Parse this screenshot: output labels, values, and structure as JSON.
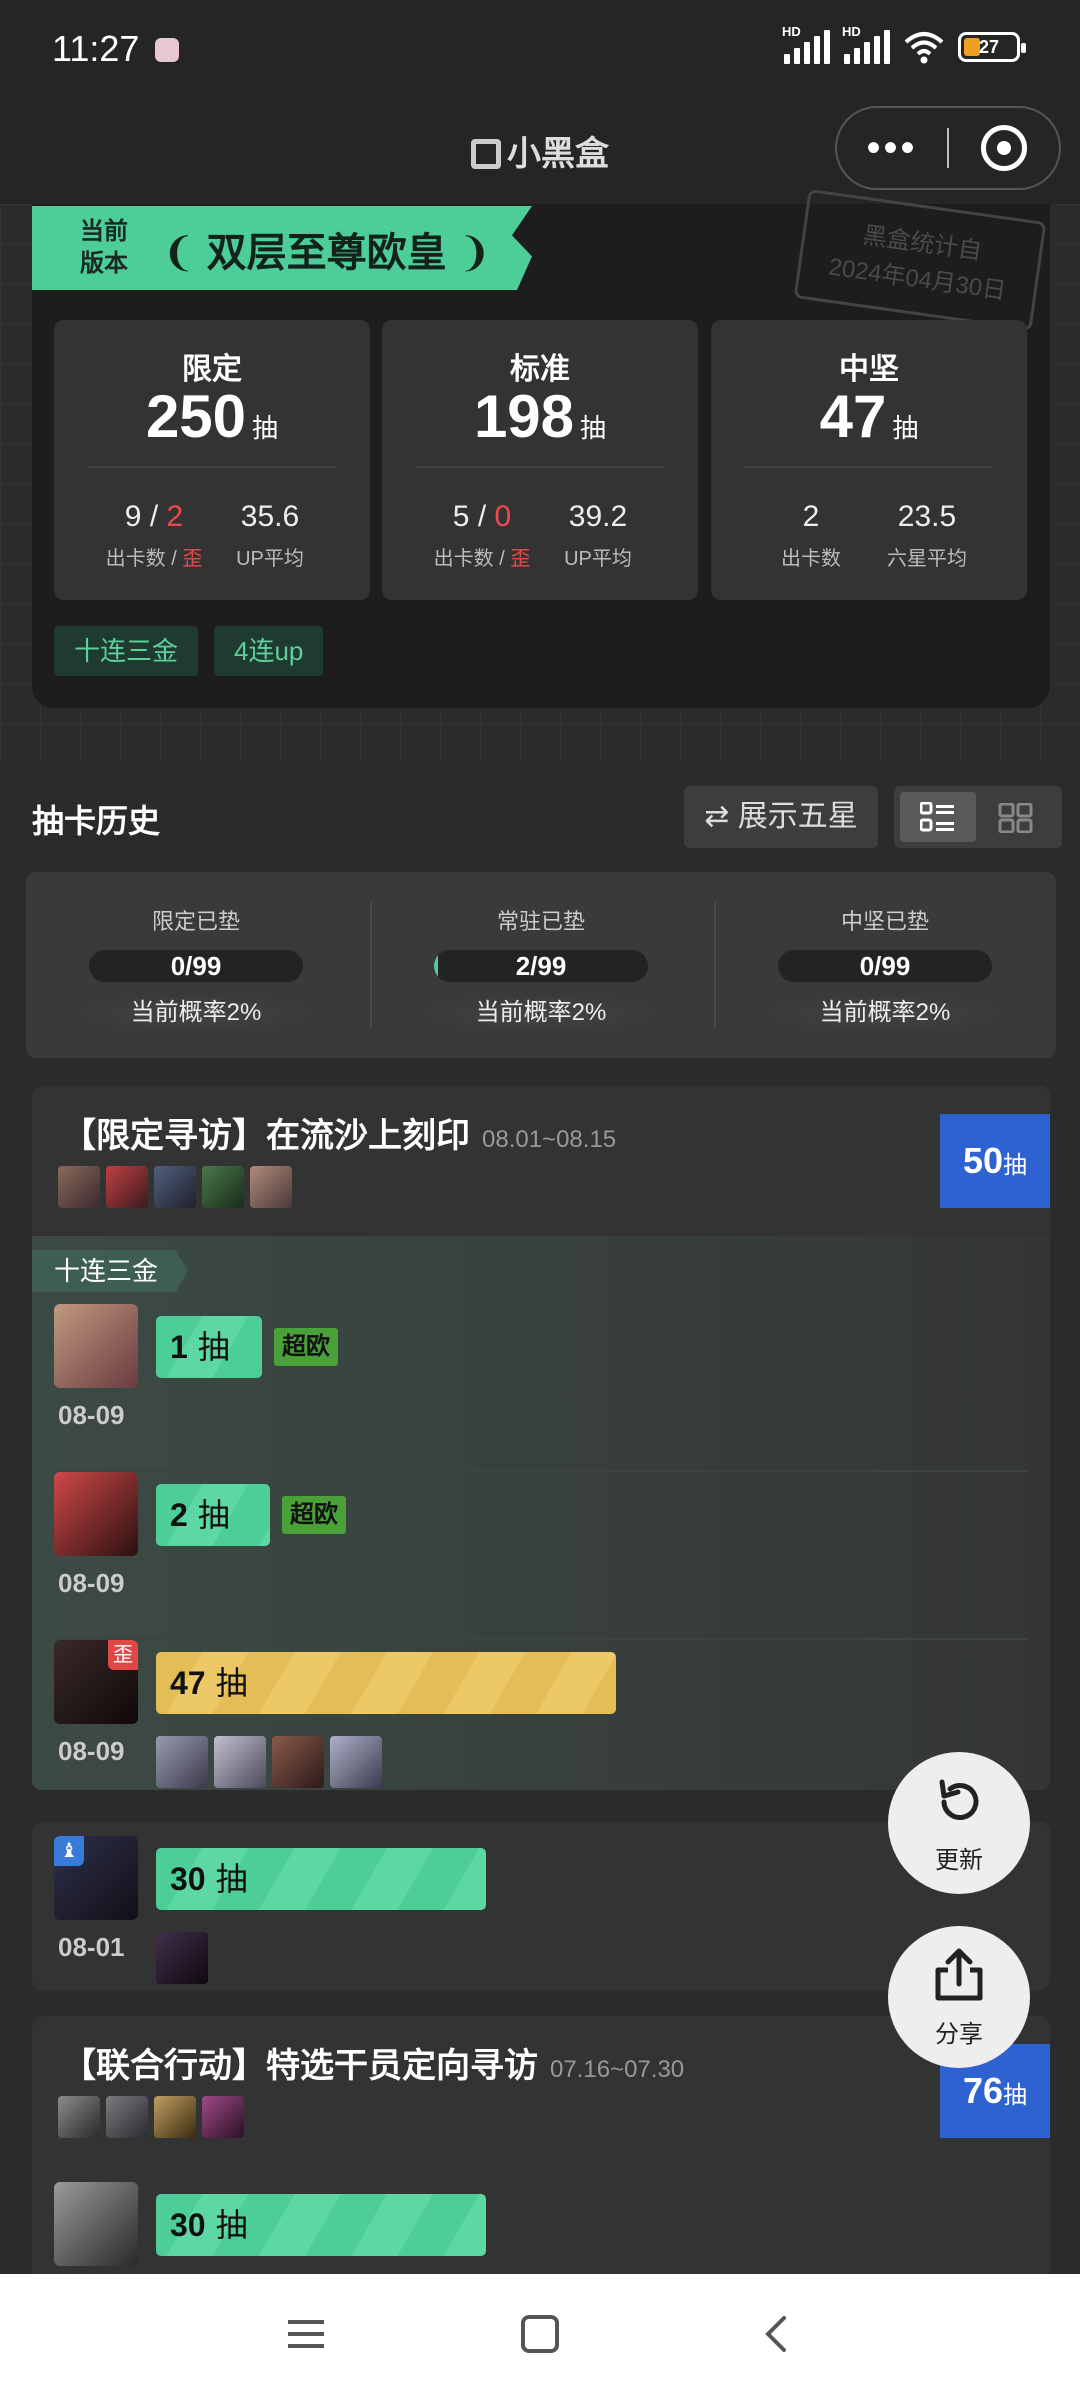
{
  "status": {
    "time": "11:27",
    "battery": "27",
    "hd1": "HD",
    "hd2": "HD"
  },
  "nav": {
    "title": "小黑盒",
    "more": "•••"
  },
  "summary": {
    "version_label": "当前\n版本",
    "version_label_1": "当前",
    "version_label_2": "版本",
    "title": "双层至尊欧皇",
    "stamp_line1": "黑盒统计自",
    "stamp_line2": "2024年04月30日",
    "unit": "抽",
    "stats": [
      {
        "label": "限定",
        "pulls": "250",
        "v1": "9 / ",
        "v1b": "2",
        "v2": "35.6",
        "s1": "出卡数 / ",
        "s1b": "歪",
        "s2": "UP平均"
      },
      {
        "label": "标准",
        "pulls": "198",
        "v1": "5 / ",
        "v1b": "0",
        "v2": "39.2",
        "s1": "出卡数 / ",
        "s1b": "歪",
        "s2": "UP平均"
      },
      {
        "label": "中坚",
        "pulls": "47",
        "v1": "2",
        "v1b": "",
        "v2": "23.5",
        "s1": "出卡数",
        "s1b": "",
        "s2": "六星平均"
      }
    ],
    "tags": [
      "十连三金",
      "4连up"
    ]
  },
  "history": {
    "title": "抽卡历史",
    "show_five": "⇄ 展示五星",
    "pity": [
      {
        "label": "限定已垫",
        "value": "0/99",
        "fill": 0,
        "prob": "当前概率2%"
      },
      {
        "label": "常驻已垫",
        "value": "2/99",
        "fill": 0.02,
        "prob": "当前概率2%"
      },
      {
        "label": "中坚已垫",
        "value": "0/99",
        "fill": 0,
        "prob": "当前概率2%"
      }
    ]
  },
  "banners": [
    {
      "title": "【限定寻访】在流沙上刻印",
      "date": "08.01~08.15",
      "count": "50",
      "count_unit": "抽",
      "tag": "十连三金",
      "rows": [
        {
          "pulls": "1",
          "unit": "抽",
          "badge": "超欧",
          "date": "08-09"
        },
        {
          "pulls": "2",
          "unit": "抽",
          "badge": "超欧",
          "date": "08-09"
        },
        {
          "pulls": "47",
          "unit": "抽",
          "badge": "",
          "date": "08-09",
          "wai": "歪"
        }
      ]
    },
    {
      "rows": [
        {
          "pulls": "30",
          "unit": "抽",
          "date": "08-01"
        }
      ]
    },
    {
      "title": "【联合行动】特选干员定向寻访",
      "date": "07.16~07.30",
      "count": "76",
      "count_unit": "抽",
      "rows": [
        {
          "pulls": "30",
          "unit": "抽"
        }
      ]
    }
  ],
  "fab": {
    "refresh": "更新",
    "share": "分享"
  },
  "colors": {
    "accent": "#4dcd97",
    "gold": "#e3bd55",
    "blue": "#2d62d0",
    "red": "#e94b4b"
  }
}
